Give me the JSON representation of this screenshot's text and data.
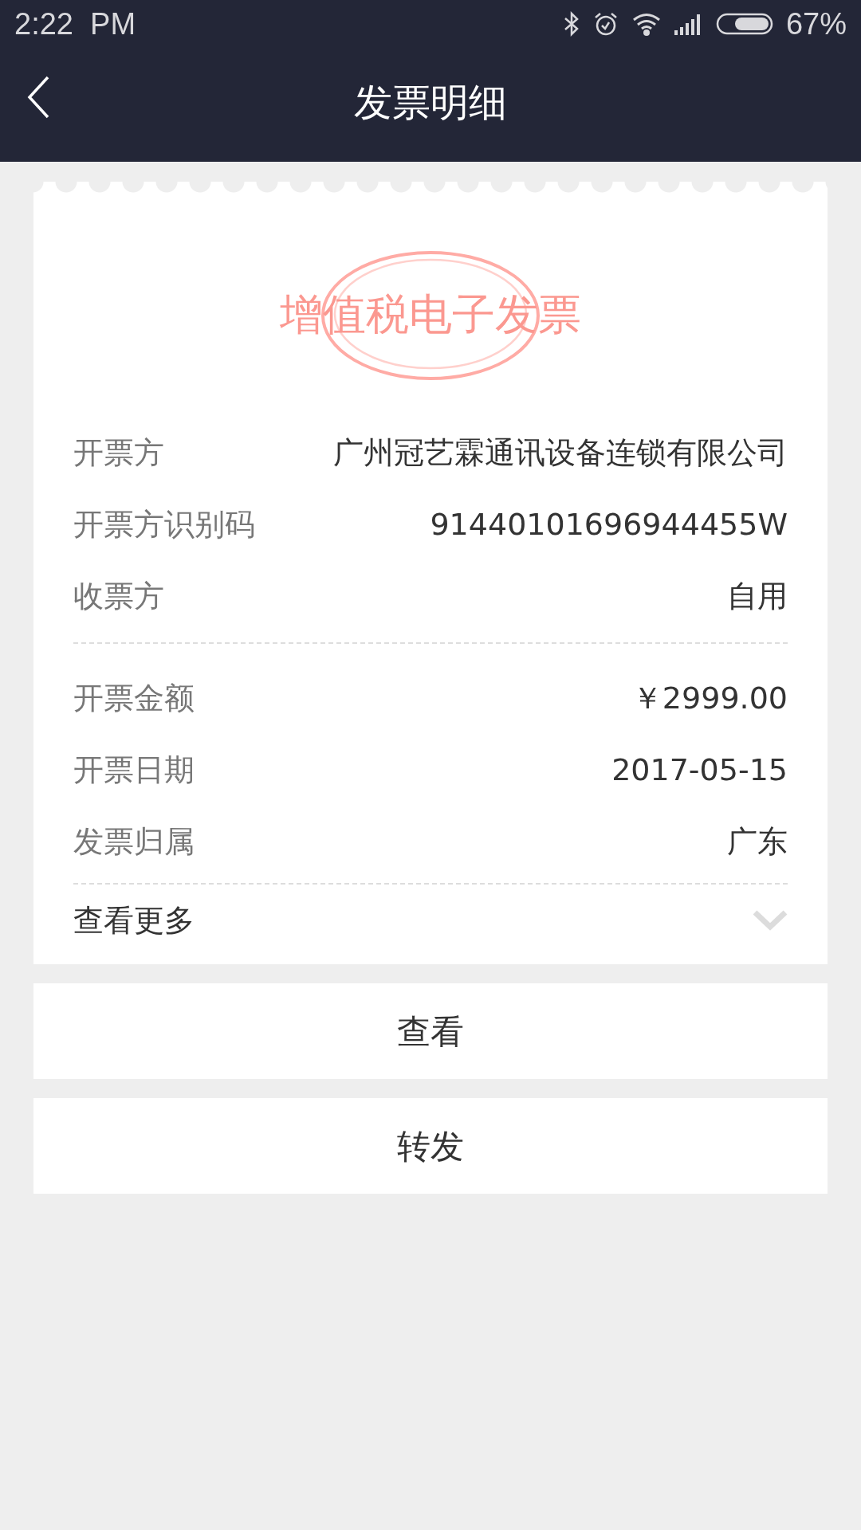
{
  "status_bar": {
    "time": "2:22  PM",
    "battery": "67%"
  },
  "nav": {
    "title": "发票明细"
  },
  "invoice": {
    "stamp": "增值税电子发票",
    "groups": [
      [
        {
          "label": "开票方",
          "value": "广州冠艺霖通讯设备连锁有限公司"
        },
        {
          "label": "开票方识别码",
          "value": "91440101696944455W"
        },
        {
          "label": "收票方",
          "value": "自用"
        }
      ],
      [
        {
          "label": "开票金额",
          "value": "￥2999.00"
        },
        {
          "label": "开票日期",
          "value": "2017-05-15"
        },
        {
          "label": "发票归属",
          "value": "广东"
        }
      ]
    ],
    "more": {
      "label": "查看更多",
      "expanded": false
    }
  },
  "buttons": [
    "查看",
    "转发"
  ]
}
